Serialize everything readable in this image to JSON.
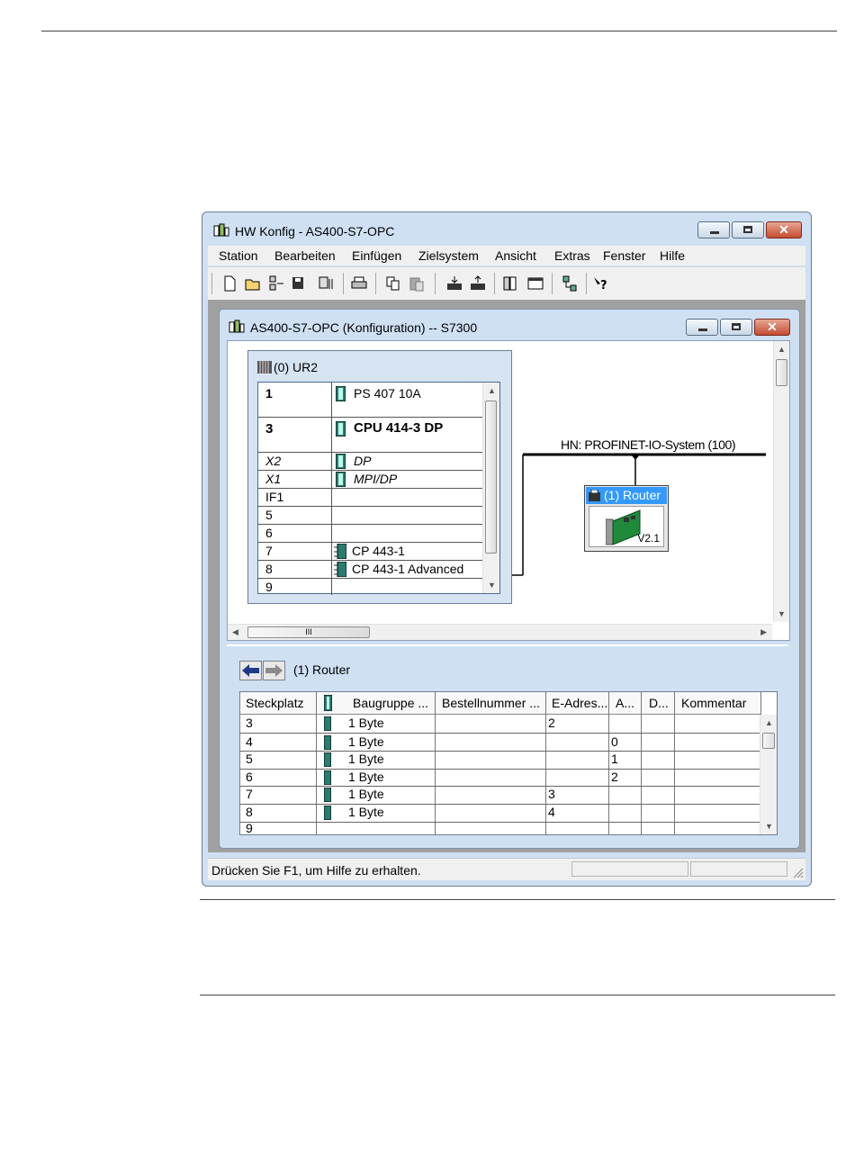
{
  "window": {
    "title": "HW Konfig - AS400-S7-OPC",
    "menu": [
      "Station",
      "Bearbeiten",
      "Einfügen",
      "Zielsystem",
      "Ansicht",
      "Extras",
      "Fenster",
      "Hilfe"
    ],
    "status": "Drücken Sie F1, um Hilfe zu erhalten."
  },
  "child": {
    "title": "AS400-S7-OPC (Konfiguration) -- S7300"
  },
  "rack": {
    "title": "(0) UR2",
    "rows": [
      {
        "slot": "1",
        "module": "PS 407 10A"
      },
      {
        "slot": "3",
        "module": "CPU 414-3 DP"
      },
      {
        "slot": "X2",
        "module": "DP"
      },
      {
        "slot": "X1",
        "module": "MPI/DP"
      },
      {
        "slot": "IF1",
        "module": ""
      },
      {
        "slot": "5",
        "module": ""
      },
      {
        "slot": "6",
        "module": ""
      },
      {
        "slot": "7",
        "module": "CP 443-1"
      },
      {
        "slot": "8",
        "module": "CP 443-1 Advanced"
      },
      {
        "slot": "9",
        "module": ""
      }
    ]
  },
  "network": {
    "label": "HN: PROFINET-IO-System (100)",
    "device_name": "(1) Router",
    "device_version": "V2.1"
  },
  "lower": {
    "label": "(1)   Router",
    "headers": [
      "Steckplatz",
      "Baugruppe ...",
      "Bestellnummer ...",
      "E-Adres...",
      "A...",
      "D...",
      "Kommentar"
    ],
    "rows": [
      {
        "slot": "3",
        "module": "1 Byte",
        "order": "",
        "e": "2",
        "a": "",
        "d": "",
        "comment": ""
      },
      {
        "slot": "4",
        "module": "1 Byte",
        "order": "",
        "e": "",
        "a": "0",
        "d": "",
        "comment": ""
      },
      {
        "slot": "5",
        "module": "1 Byte",
        "order": "",
        "e": "",
        "a": "1",
        "d": "",
        "comment": ""
      },
      {
        "slot": "6",
        "module": "1 Byte",
        "order": "",
        "e": "",
        "a": "2",
        "d": "",
        "comment": ""
      },
      {
        "slot": "7",
        "module": "1 Byte",
        "order": "",
        "e": "3",
        "a": "",
        "d": "",
        "comment": ""
      },
      {
        "slot": "8",
        "module": "1 Byte",
        "order": "",
        "e": "4",
        "a": "",
        "d": "",
        "comment": ""
      },
      {
        "slot": "9",
        "module": "",
        "order": "",
        "e": "",
        "a": "",
        "d": "",
        "comment": ""
      }
    ]
  },
  "scroll_thumb": "III",
  "icons": {
    "app": "hw-config-icon",
    "toolbar": [
      "new-icon",
      "open-icon",
      "online-icon",
      "save-icon",
      "compile-icon",
      "print-icon",
      "copy-icon",
      "paste-icon",
      "download-icon",
      "upload-icon",
      "catalog-icon",
      "window-icon",
      "network-icon",
      "help-icon"
    ]
  },
  "colors": {
    "title_bg": "#cfe0f3",
    "selected": "#3399ff",
    "close": "#c44c31"
  }
}
